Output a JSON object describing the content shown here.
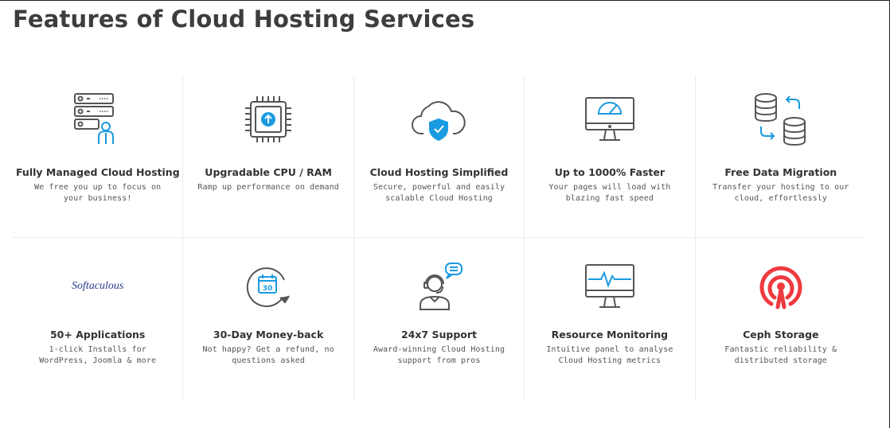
{
  "page": {
    "title": "Features of Cloud Hosting Services"
  },
  "colors": {
    "accent": "#1a9ae0",
    "icon_dark": "#555555",
    "ceph_red": "#ef3a3f",
    "softaculous_blue": "#2a3c8c"
  },
  "features": [
    {
      "title": "Fully Managed Cloud Hosting",
      "desc": "We free you up to focus on your business!",
      "icon": "server-admin-icon"
    },
    {
      "title": "Upgradable CPU / RAM",
      "desc": "Ramp up performance on demand",
      "icon": "cpu-chip-icon"
    },
    {
      "title": "Cloud Hosting Simplified",
      "desc": "Secure, powerful and easily scalable Cloud Hosting",
      "icon": "cloud-shield-icon"
    },
    {
      "title": "Up to 1000% Faster",
      "desc": "Your pages will load with blazing fast speed",
      "icon": "speed-monitor-icon"
    },
    {
      "title": "Free Data Migration",
      "desc": "Transfer your hosting to our cloud, effortlessly",
      "icon": "database-migration-icon"
    },
    {
      "title": "50+ Applications",
      "desc": "1-click Installs for WordPress, Joomla & more",
      "icon": "softaculous-logo",
      "logo_text": "Softaculous"
    },
    {
      "title": "30-Day Money-back",
      "desc": "Not happy? Get a refund, no questions asked",
      "icon": "calendar-refresh-icon",
      "calendar_day": "30"
    },
    {
      "title": "24x7 Support",
      "desc": "Award-winning Cloud Hosting support from pros",
      "icon": "support-agent-icon"
    },
    {
      "title": "Resource Monitoring",
      "desc": "Intuitive panel to analyse Cloud Hosting metrics",
      "icon": "monitor-pulse-icon"
    },
    {
      "title": "Ceph Storage",
      "desc": "Fantastic reliability & distributed storage",
      "icon": "ceph-logo"
    }
  ]
}
